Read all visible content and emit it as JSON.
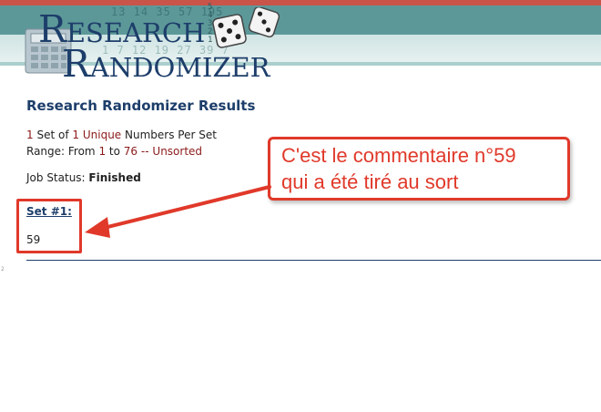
{
  "header": {
    "logo_line1": "Research",
    "logo_line2": "Randomizer",
    "digits_top": "13 14 35 57 195",
    "digits_side": "5 4 3 2 1",
    "digits_bottom": "1 7 12 19 27 39 7"
  },
  "results": {
    "title": "Research Randomizer Results",
    "summary_sets": "1",
    "summary_set_of": "Set of",
    "summary_unique_count": "1",
    "summary_unique": "Unique",
    "summary_per_set": "Numbers Per Set",
    "range_label": "Range: From",
    "range_from": "1",
    "range_to_label": "to",
    "range_to": "76",
    "range_sep": "--",
    "range_sort": "Unsorted",
    "job_status_label": "Job Status:",
    "job_status_value": "Finished",
    "set_title": "Set #1:",
    "set_values": "59",
    "tiny_mark": "2"
  },
  "annotation": {
    "line1": "C'est le commentaire n°59",
    "line2": "qui a été tiré au sort"
  },
  "colors": {
    "accent": "#e0392a",
    "navy": "#1d3e6a",
    "teal": "#5d9899",
    "highlight_text": "#8b1a1a"
  }
}
